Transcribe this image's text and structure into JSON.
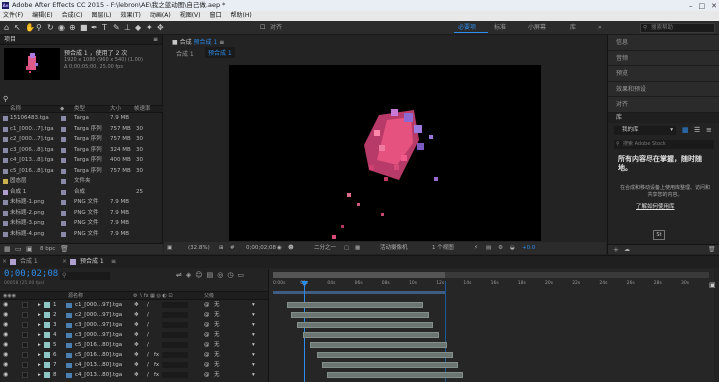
{
  "title": "Adobe After Effects CC 2015 - F:\\lebron\\AE\\我之蓝动图\\自己做.aep *",
  "menu": [
    "文件(F)",
    "编辑(E)",
    "合成(C)",
    "图层(L)",
    "效果(T)",
    "动画(A)",
    "视图(V)",
    "窗口",
    "帮助(H)"
  ],
  "toolbar": {
    "align_label": "对齐",
    "workspaces": [
      {
        "label": "必要项",
        "active": true
      },
      {
        "label": "标准",
        "active": false
      },
      {
        "label": "小屏幕",
        "active": false
      },
      {
        "label": "库",
        "active": false
      }
    ],
    "search_placeholder": "搜索帮助"
  },
  "project": {
    "panel_label": "项目",
    "comp_name": "预合成 1",
    "comp_used": "，使用了 2 次",
    "comp_info1": "1920 x 1080 (960 x 540) (1.00)",
    "comp_info2": "Δ 0;00;05;00, 25.00 fps",
    "col_name": "名称",
    "col_type": "类型",
    "col_size": "大小",
    "col_fps": "帧速率",
    "items": [
      {
        "name": "15106483.tga",
        "type": "Targa",
        "size": "7.9 MB",
        "fps": "",
        "color": "#8a8aa8"
      },
      {
        "name": "c1_[000...7].tga",
        "type": "Targa 序列",
        "size": "757 MB",
        "fps": "30",
        "color": "#8a8aa8"
      },
      {
        "name": "c2_[000...7].tga",
        "type": "Targa 序列",
        "size": "757 MB",
        "fps": "30",
        "color": "#8a8aa8"
      },
      {
        "name": "c3_[006...8].tga",
        "type": "Targa 序列",
        "size": "324 MB",
        "fps": "30",
        "color": "#8a8aa8"
      },
      {
        "name": "c4_[013...8].tga",
        "type": "Targa 序列",
        "size": "400 MB",
        "fps": "30",
        "color": "#8a8aa8"
      },
      {
        "name": "c5_[016...8].tga",
        "type": "Targa 序列",
        "size": "757 MB",
        "fps": "30",
        "color": "#8a8aa8"
      },
      {
        "name": "固态层",
        "type": "文件夹",
        "size": "",
        "fps": "",
        "color": "#c8b050"
      },
      {
        "name": "合成 1",
        "type": "合成",
        "size": "",
        "fps": "25",
        "color": "#b0a0d0"
      },
      {
        "name": "未标题-1.png",
        "type": "PNG 文件",
        "size": "7.9 MB",
        "fps": "",
        "color": "#8a8aa8"
      },
      {
        "name": "未标题-2.png",
        "type": "PNG 文件",
        "size": "7.9 MB",
        "fps": "",
        "color": "#8a8aa8"
      },
      {
        "name": "未标题-3.png",
        "type": "PNG 文件",
        "size": "7.9 MB",
        "fps": "",
        "color": "#8a8aa8"
      },
      {
        "name": "未标题-4.png",
        "type": "PNG 文件",
        "size": "7.9 MB",
        "fps": "",
        "color": "#8a8aa8"
      }
    ],
    "bpc": "8 bpc"
  },
  "viewer": {
    "tab_label": "合成",
    "comp_tab": "预合成 1",
    "sub_tabs": [
      "合成 1",
      "预合成 1"
    ],
    "zoom": "(32.8%)",
    "timecode": "0;00;02;08",
    "resolution": "二分之一",
    "camera": "活动摄像机",
    "views": "1 个视图",
    "exposure": "+0.0"
  },
  "right_panels": [
    "信息",
    "音频",
    "预览",
    "效果和预设",
    "对齐"
  ],
  "library": {
    "title": "库",
    "my_library": "我的库",
    "search_placeholder": "搜索 Adobe Stock",
    "headline": "所有内容尽在掌握，随时随地。",
    "body": "在合成和移动设备上使用库整理、访问和共享您的内容。",
    "link": "了解如何使用库",
    "footer_size": "St"
  },
  "timeline": {
    "tabs": [
      "合成 1",
      "预合成 1"
    ],
    "timecode": "0;00;02;08",
    "timecode_sub": "00058 (25.00 fps)",
    "col_source": "源名称",
    "col_parent": "父级",
    "ruler": [
      "0:00s",
      "02s",
      "04s",
      "06s",
      "08s",
      "10s",
      "12s",
      "14s",
      "16s",
      "18s",
      "20s",
      "22s",
      "24s",
      "26s",
      "28s",
      "30s"
    ],
    "layers": [
      {
        "num": "1",
        "name": "c1_[000...97].tga",
        "parent": "无",
        "bar_start": 1,
        "bar_end": 11,
        "fx": false
      },
      {
        "num": "2",
        "name": "c2_[000...97].tga",
        "parent": "无",
        "bar_start": 1.3,
        "bar_end": 11.5,
        "fx": false
      },
      {
        "num": "3",
        "name": "c3_[000...97].tga",
        "parent": "无",
        "bar_start": 1.8,
        "bar_end": 11.8,
        "fx": false
      },
      {
        "num": "4",
        "name": "c3_[000...97].tga",
        "parent": "无",
        "bar_start": 2.2,
        "bar_end": 12.2,
        "fx": false
      },
      {
        "num": "5",
        "name": "c5_[016...80].tga",
        "parent": "无",
        "bar_start": 2.7,
        "bar_end": 12.8,
        "fx": false
      },
      {
        "num": "6",
        "name": "c5_[016...80].tga",
        "parent": "无",
        "bar_start": 3.2,
        "bar_end": 13.2,
        "fx": true
      },
      {
        "num": "7",
        "name": "c4_[013...80].tga",
        "parent": "无",
        "bar_start": 3.6,
        "bar_end": 13.6,
        "fx": true
      },
      {
        "num": "8",
        "name": "c4_[013...80].tga",
        "parent": "无",
        "bar_start": 4.0,
        "bar_end": 14.0,
        "fx": true
      }
    ]
  }
}
